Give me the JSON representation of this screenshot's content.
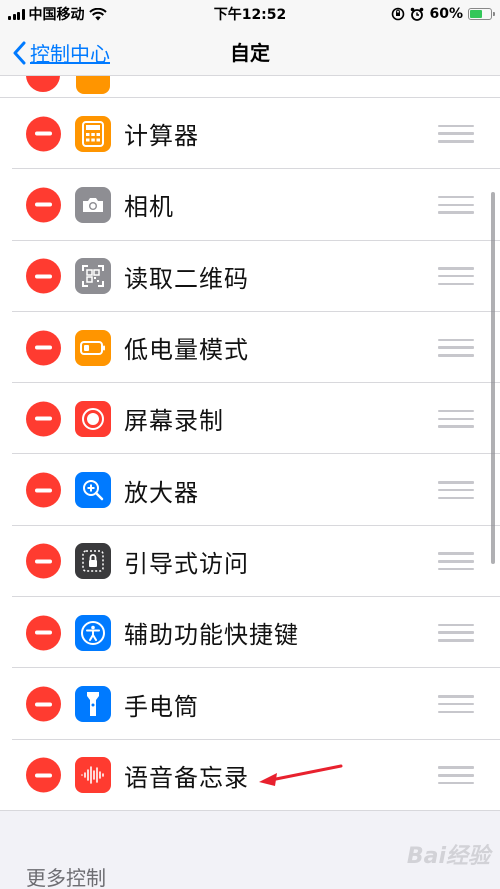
{
  "status_bar": {
    "carrier": "中国移动",
    "time": "下午12:52",
    "battery_percent": "60%",
    "battery_level": 0.6
  },
  "nav": {
    "back_label": "控制中心",
    "title": "自定"
  },
  "controls": [
    {
      "label": "计算器",
      "icon": "calculator-icon",
      "color": "#ff9500"
    },
    {
      "label": "相机",
      "icon": "camera-icon",
      "color": "#8e8e93"
    },
    {
      "label": "读取二维码",
      "icon": "qr-code-icon",
      "color": "#8e8e93"
    },
    {
      "label": "低电量模式",
      "icon": "low-power-icon",
      "color": "#ff9500"
    },
    {
      "label": "屏幕录制",
      "icon": "screen-record-icon",
      "color": "#ff3b30"
    },
    {
      "label": "放大器",
      "icon": "magnifier-icon",
      "color": "#007aff"
    },
    {
      "label": "引导式访问",
      "icon": "guided-access-icon",
      "color": "#3a3a3c"
    },
    {
      "label": "辅助功能快捷键",
      "icon": "accessibility-icon",
      "color": "#007aff"
    },
    {
      "label": "手电筒",
      "icon": "flashlight-icon",
      "color": "#007aff"
    },
    {
      "label": "语音备忘录",
      "icon": "voice-memo-icon",
      "color": "#ff3b30"
    }
  ],
  "more_section": {
    "header": "更多控制"
  },
  "watermark": {
    "text": "Bai经验"
  }
}
